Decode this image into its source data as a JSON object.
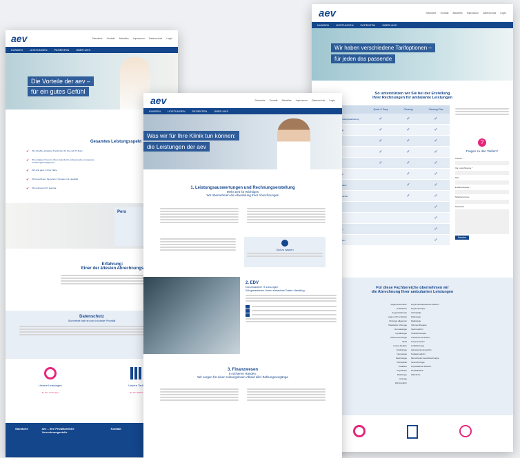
{
  "left": {
    "nav_links": [
      "Standorte",
      "Kontakt",
      "Aktuelles",
      "Impressum",
      "Datenschutz",
      "Login"
    ],
    "menu": [
      "KUNDEN",
      "LEISTUNGEN",
      "PATIENTEN",
      "ÜBER UNS"
    ],
    "hero_line1": "Die Vorteile der aev –",
    "hero_line2": "für ein gutes Gefühl",
    "section_title": "Gesamtes Leistungsspekt",
    "benefits_a": [
      "Wir schaffen attraktive Preishöhen für Sie und Ihr Team",
      "Wir entlasten Ihnen zu Ihrem Geld durch professionelle, kompetente Forderungsmanagement",
      "Wir sind ganz in Ihrer Nähe",
      "Wir bezeichnen Sie schon 3 Stunden mit Liquidität",
      "Wir optimieren Ihr Honorar"
    ],
    "persa": "Pers",
    "erfahrung_title": "Erfahrung:",
    "erfahrung_sub": "Einer der ältesten Abrechnungs",
    "datenschutz_title": "Datenschutz",
    "datenschutz_sub": "Sicherheit hat bei uns höchste Priorität",
    "card1_title": "Unsere Leistungen",
    "card1_link": "Zu den Leistungen",
    "card2_title": "Unsere Tarife",
    "card2_link": "Zu den Tarifen",
    "footer_col1": "Standorte",
    "footer_col2": "aev – Ihre Privatärztliche Verrechnungsstelle",
    "footer_col3": "Kontakt"
  },
  "right": {
    "logo_text": "aev",
    "nav_links": [
      "Standorte",
      "Kontakt",
      "Aktuelles",
      "Impressum",
      "Datenschutz",
      "Login"
    ],
    "menu": [
      "KUNDEN",
      "LEISTUNGEN",
      "PATIENTEN",
      "ÜBER UNS"
    ],
    "hero_line1": "Wir haben verschiedene Tarifoptionen –",
    "hero_line2": "für jeden das passende",
    "section_title_1": "So unterstützen wir Sie bei der Erstellung",
    "section_title_2": "Ihrer Rechnungen für ambulante Leistungen",
    "table_headers": [
      "Tarif",
      "Quick & Easy",
      "Clearing",
      "Clearing Plus"
    ],
    "table_rows": [
      "Leistungskatalogbearbeitung",
      "Abrechnung",
      "Zeitung",
      "Forderung",
      "Inkasso",
      "Mahnwesen",
      "Kommunikation",
      "Honorarkontrolle",
      "Abtretung",
      "Beratung",
      "Aufnahmen",
      "Unterschriften"
    ],
    "form_title": "Fragen zu den Tarifen?",
    "form_fields": [
      "Anrede *",
      "Vor- und Zuname *",
      "Titel",
      "E-Mail Adresse *",
      "Telefonnummer",
      "Nachricht"
    ],
    "form_button": "Senden",
    "fach_title_1": "Für diese Fachbereiche übernehmen wir",
    "fach_title_2": "die Abrechnung Ihrer ambulanten Leistungen",
    "fach_left": [
      "Allgemeinmedizin",
      "Anästhesie",
      "Augenheilkunde",
      "Augen-OP ambulant",
      "Chirurgie allgemein",
      "Plastische Chirurgie",
      "Dermatologie",
      "Gynäkologie",
      "Gastroenterologie",
      "HNO",
      "Innere Medizin",
      "Kardiologie",
      "Neurologie",
      "Nephrologie",
      "Orthopädie",
      "Pädiatrie",
      "Psychiatrie",
      "Radiologie",
      "Urologie",
      "Zahnmedizin"
    ],
    "fach_right": [
      "Psychotherapeutische Medizin",
      "Psychotherapie",
      "Orthopädie",
      "Pathologie",
      "Radiologie",
      "Schmerztherapie",
      "Sportmedizin",
      "Strahlentherapie",
      "Transfusionsmedizin",
      "Tropenmedizin",
      "Unfallchirurgie",
      "Laboratoriumsmedizin",
      "Nuklearmedizin",
      "Mund-Kiefer-Gesichtschirurgie",
      "Neurochirurgie",
      "Physikalische Medizin",
      "Rehabilitation",
      "Zahnärzte"
    ]
  },
  "center": {
    "nav_links": [
      "Standorte",
      "Kontakt",
      "Aktuelles",
      "Impressum",
      "Datenschutz",
      "Login"
    ],
    "menu": [
      "KUNDEN",
      "LEISTUNGEN",
      "PATIENTEN",
      "ÜBER UNS"
    ],
    "hero_line1": "Was wir für Ihre Klinik tun können:",
    "hero_line2": "die Leistungen der aev",
    "s1_title": "1. Leistungsauswertungen und Rechnungserstellung",
    "s1_sub1": "Mehr Zeit für Wichtiges",
    "s1_sub2": "Wir übernehmen die Abwicklung Ihrer Abrechnungen",
    "s1_box_title": "Gut zu wissen",
    "s2_title": "2. EDV",
    "s2_sub1": "Durchdachter IT-Lösungen",
    "s2_sub2": "Wir garantieren Ihnen einfaches Daten-Handling",
    "s3_title": "3. Finanzwesen",
    "s3_sub1": "In sicheren Händen:",
    "s3_sub2": "Wir sorgen für einen reibungslosen Ablauf aller Zahlungsvorgänge"
  },
  "colors": {
    "brand_blue": "#14468c",
    "accent_pink": "#e5267a",
    "light_blue_bg": "#e8eef6"
  }
}
